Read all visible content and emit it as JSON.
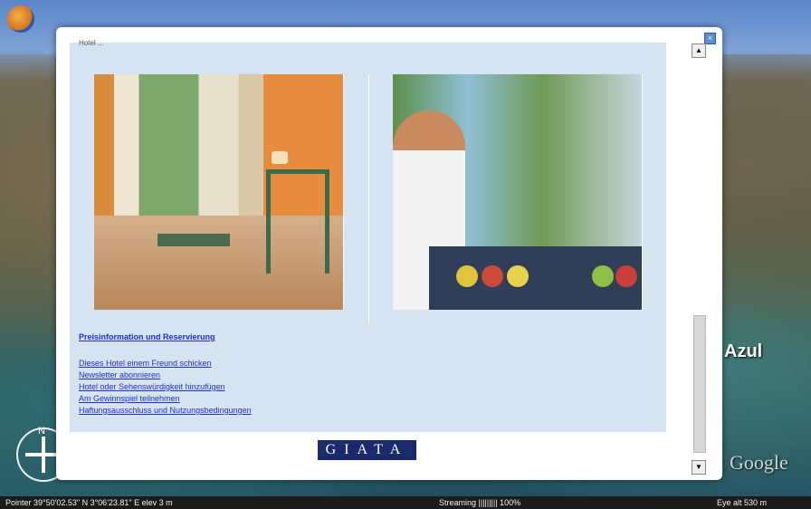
{
  "background_labels": {
    "place": "Azul",
    "google": "Google"
  },
  "status_bar": {
    "pointer": "Pointer  39°50'02.53\" N    3°06'23.81\"  E   elev   3 m",
    "streaming": "Streaming ||||||||| 100%",
    "eye_alt": "Eye  alt    530 m"
  },
  "popup": {
    "top_text": "Hotel ...",
    "links": {
      "main": "Preisinformation und Reservierung",
      "items": [
        "Dieses Hotel einem Freund schicken",
        "Newsletter abonnieren",
        "Hotel oder Sehenswürdigkeit hinzufügen",
        "Am Gewinnspiel teilnehmen",
        "Haftungsausschluss und Nutzungsbedingungen"
      ]
    },
    "footer_logo": "GIATA"
  },
  "compass": {
    "north": "N"
  },
  "colors": {
    "link": "#1e2fd1",
    "panel": "#d6e4f2",
    "logo_bg": "#1b2a6a"
  },
  "icons": {
    "logo": "globe-logo-icon",
    "close": "close-icon",
    "scroll_up": "scroll-up-icon",
    "scroll_down": "scroll-down-icon"
  }
}
